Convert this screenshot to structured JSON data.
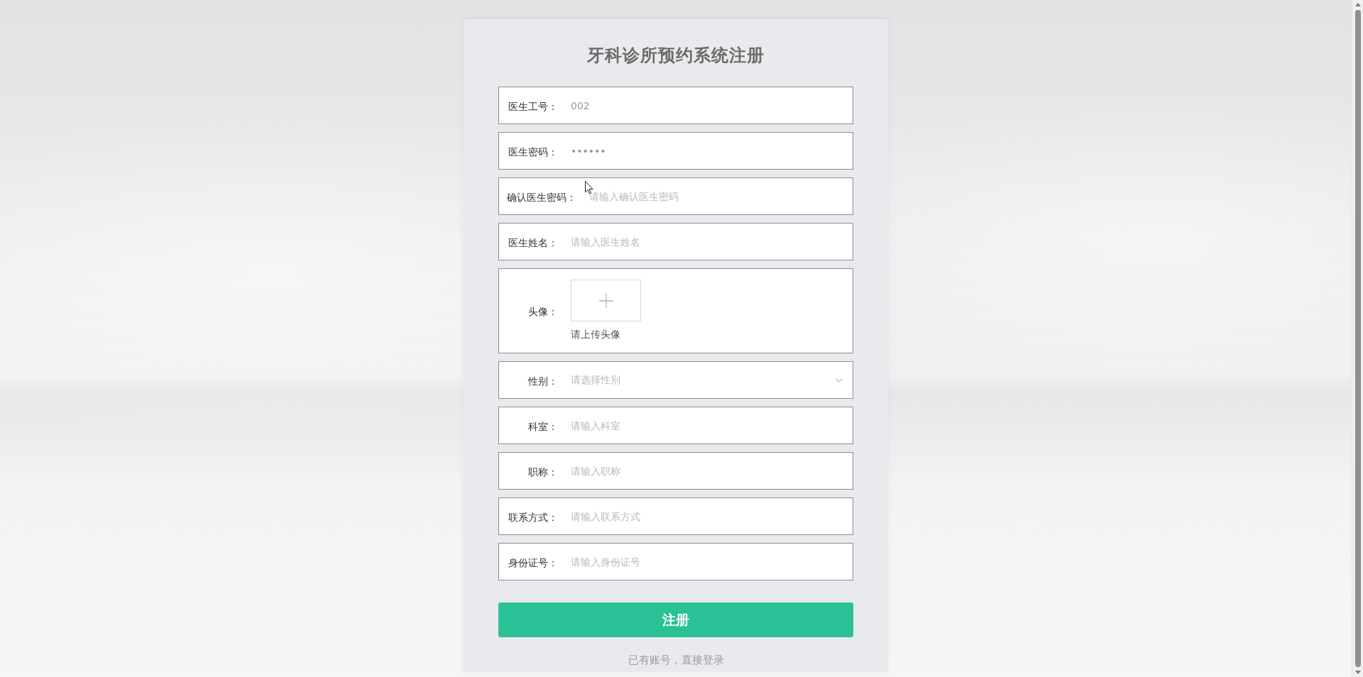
{
  "title": "牙科诊所预约系统注册",
  "fields": [
    {
      "kind": "text",
      "label": "医生工号：",
      "value": "002"
    },
    {
      "kind": "text",
      "label": "医生密码：",
      "value": "••••••"
    },
    {
      "kind": "text",
      "label": "确认医生密码：",
      "placeholder": "请输入确认医生密码"
    },
    {
      "kind": "text",
      "label": "医生姓名：",
      "placeholder": "请输入医生姓名"
    },
    {
      "kind": "upload",
      "label": "头像：",
      "hint": "请上传头像"
    },
    {
      "kind": "select",
      "label": "性别：",
      "placeholder": "请选择性别"
    },
    {
      "kind": "text",
      "label": "科室：",
      "placeholder": "请输入科室"
    },
    {
      "kind": "text",
      "label": "职称：",
      "placeholder": "请输入职称"
    },
    {
      "kind": "text",
      "label": "联系方式：",
      "placeholder": "请输入联系方式"
    },
    {
      "kind": "text",
      "label": "身份证号：",
      "placeholder": "请输入身份证号"
    }
  ],
  "submit_button": "注册",
  "login_link": "已有账号，直接登录"
}
